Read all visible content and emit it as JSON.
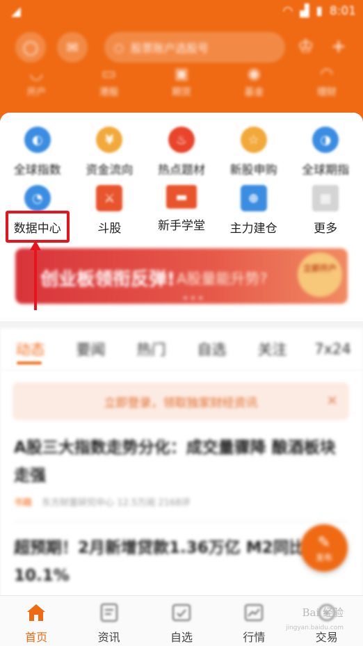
{
  "status_bar": {
    "time": "8:01"
  },
  "header": {
    "search_placeholder": "股票账户选股号",
    "shortcuts": [
      {
        "label": "开户",
        "icon": "bank-icon"
      },
      {
        "label": "港股",
        "icon": "hk-icon"
      },
      {
        "label": "期货",
        "icon": "futures-icon"
      },
      {
        "label": "基金",
        "icon": "fund-icon"
      },
      {
        "label": "理财",
        "icon": "wealth-icon"
      }
    ]
  },
  "grid": {
    "row1": [
      {
        "label": "全球指数",
        "color": "#3a8de0"
      },
      {
        "label": "资金流向",
        "color": "#f2a93b"
      },
      {
        "label": "热点题材",
        "color": "#e8452c"
      },
      {
        "label": "新股申购",
        "color": "#f2a93b"
      },
      {
        "label": "全球期指",
        "color": "#3a8de0"
      }
    ],
    "row2": [
      {
        "label": "数据中心",
        "color": "#3a8de0"
      },
      {
        "label": "斗股",
        "color": "#e8542c"
      },
      {
        "label": "新手学堂",
        "color": "#e8542c"
      },
      {
        "label": "主力建仓",
        "color": "#3a8de0"
      },
      {
        "label": "更多",
        "color": "#cccccc"
      }
    ]
  },
  "banner": {
    "title": "创业板领衔反弹!",
    "subtitle": "A股量能升势?",
    "button": "立即开户"
  },
  "tabs": [
    "动态",
    "要闻",
    "热门",
    "自选",
    "关注",
    "7x24"
  ],
  "login_tip": {
    "text": "立即登录，领取独家财经资讯"
  },
  "news": [
    {
      "title": "A股三大指数走势分化：成交量骤降 酿酒板块走强",
      "tag": "书籍",
      "source": "东方财富研究中心",
      "views": "12.5万阅 2168评"
    },
    {
      "title": "超预期！2月新增贷款1.36万亿 M2同比增长10.1%"
    }
  ],
  "fab_label": "发布",
  "bottom_nav": [
    {
      "label": "首页",
      "icon": "home-icon"
    },
    {
      "label": "资讯",
      "icon": "news-icon"
    },
    {
      "label": "自选",
      "icon": "watchlist-icon"
    },
    {
      "label": "行情",
      "icon": "market-icon"
    },
    {
      "label": "交易",
      "icon": "trade-icon"
    }
  ],
  "watermark": {
    "text": "Bai 经验",
    "sub": "jingyan.baidu.com"
  },
  "colors": {
    "brand": "#ef6a13",
    "highlight": "#e8141d"
  }
}
